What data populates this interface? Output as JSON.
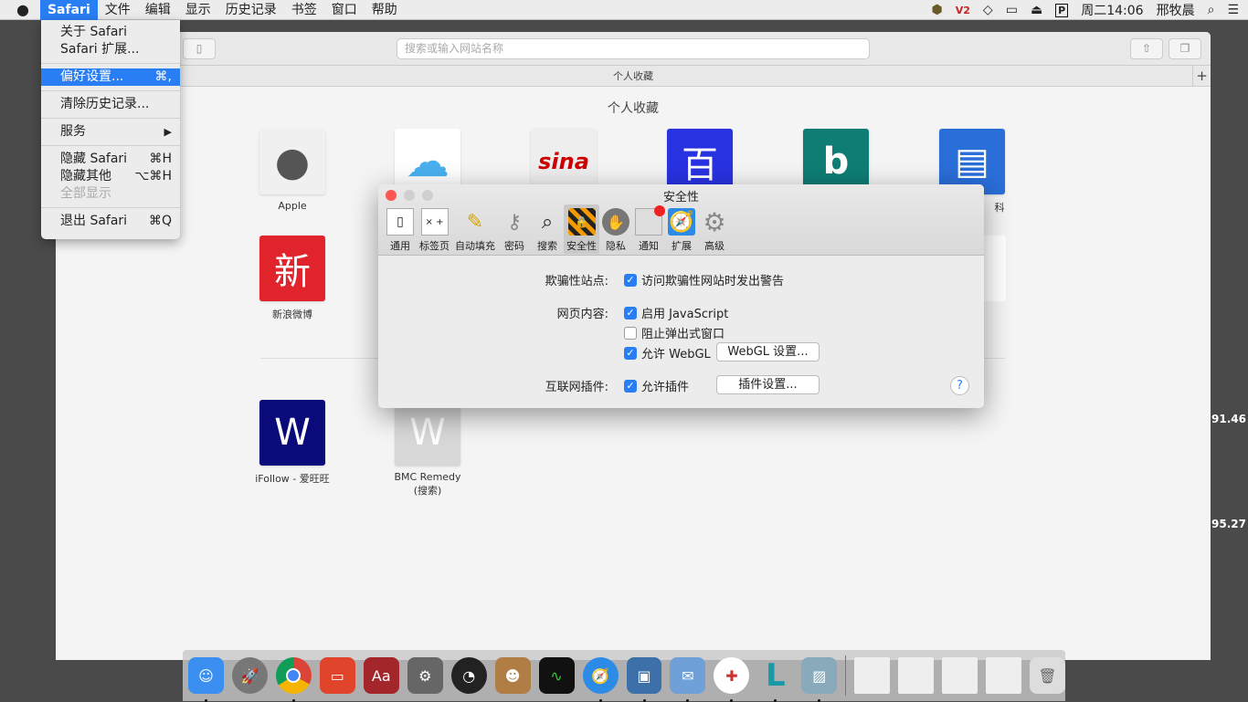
{
  "menubar": {
    "apple": "",
    "app": "Safari",
    "items": [
      "文件",
      "编辑",
      "显示",
      "历史记录",
      "书签",
      "窗口",
      "帮助"
    ],
    "clock": "周二14:06",
    "user": "邢牧晨"
  },
  "safari_menu": {
    "about": "关于 Safari",
    "extensions": "Safari 扩展...",
    "prefs": "偏好设置...",
    "prefs_sc": "⌘,",
    "clear": "清除历史记录...",
    "services": "服务",
    "hide": "隐藏 Safari",
    "hide_sc": "⌘H",
    "hide_others": "隐藏其他",
    "hide_others_sc": "⌥⌘H",
    "show_all": "全部显示",
    "quit": "退出 Safari",
    "quit_sc": "⌘Q"
  },
  "browser": {
    "search_placeholder": "搜索或输入网站名称",
    "favbar_title": "个人收藏",
    "page_title": "个人收藏",
    "favorites": [
      {
        "label": "Apple",
        "glyph": "",
        "color": "#f0f0f0"
      },
      {
        "label": "",
        "glyph": "☁",
        "color": "#ffffff"
      },
      {
        "label": "",
        "glyph": "sina",
        "color": "#eeeeee"
      },
      {
        "label": "",
        "glyph": "百",
        "color": "#2932e1"
      },
      {
        "label": "",
        "glyph": "b",
        "color": "#0f7d74"
      },
      {
        "label": "科",
        "glyph": "▤",
        "color": "#2a6ed8"
      }
    ],
    "row2": [
      {
        "label": "新浪微博",
        "glyph": "新",
        "color": "#e1242b"
      }
    ],
    "row3": [
      {
        "label": "iFollow - 爱旺旺",
        "glyph": "W",
        "color": "#0a0a7a"
      },
      {
        "label": "BMC Remedy\n(搜索)",
        "glyph": "W",
        "color": "#d8d8d8"
      }
    ],
    "side_texts": [
      "91.46",
      "95.27"
    ]
  },
  "prefs": {
    "title": "安全性",
    "tabs": [
      "通用",
      "标签页",
      "自动填充",
      "密码",
      "搜索",
      "安全性",
      "隐私",
      "通知",
      "扩展",
      "高级"
    ],
    "selected_tab": "安全性",
    "fraud_label": "欺骗性站点:",
    "fraud_opt": "访问欺骗性网站时发出警告",
    "fraud_checked": true,
    "content_label": "网页内容:",
    "js": "启用 JavaScript",
    "js_checked": true,
    "popup": "阻止弹出式窗口",
    "popup_checked": false,
    "webgl": "允许 WebGL",
    "webgl_checked": true,
    "webgl_btn": "WebGL 设置...",
    "plugins_label": "互联网插件:",
    "plugins": "允许插件",
    "plugins_checked": true,
    "plugins_btn": "插件设置...",
    "help": "?"
  },
  "dock": [
    "Finder",
    "Launchpad",
    "Chrome",
    "Remote Desktop",
    "Dictionary",
    "System Preferences",
    "Dashboard",
    "Contacts",
    "Activity Monitor",
    "Safari",
    "VirtualBox",
    "Mail",
    "CrossOver",
    "Lync",
    "Preview",
    "",
    "",
    "",
    "",
    "Trash"
  ]
}
